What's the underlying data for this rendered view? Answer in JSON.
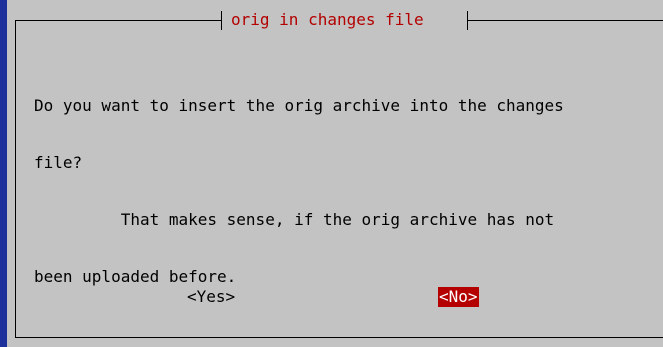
{
  "dialog": {
    "title": "orig in changes file",
    "message_lines": [
      "Do you want to insert the orig archive into the changes",
      "file?",
      "         That makes sense, if the orig archive has not",
      "been uploaded before."
    ]
  },
  "buttons": {
    "yes_label": "<Yes>",
    "no_label": "<No>",
    "selected": "no"
  },
  "colors": {
    "screen_background": "#1c2f9a",
    "dialog_background": "#c3c3c3",
    "title_text": "#b30000",
    "selected_button_background": "#b50000",
    "selected_button_text": "#ffffff"
  }
}
